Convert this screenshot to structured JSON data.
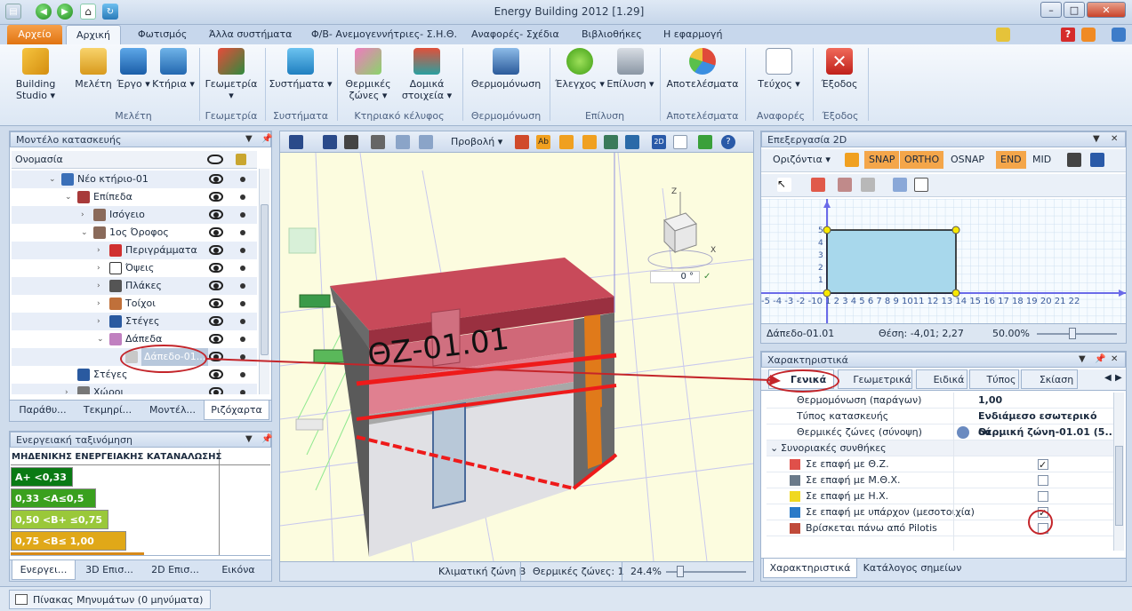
{
  "app": {
    "title": "Energy Building 2012 [1.29]"
  },
  "ribbon_tabs": [
    "Αρχείο",
    "Αρχική",
    "Φωτισμός",
    "Άλλα συστήματα",
    "Φ/Β- Ανεμογεννήτριες- Σ.Η.Θ.",
    "Αναφορές- Σχέδια",
    "Βιβλιοθήκες",
    "Η εφαρμογή"
  ],
  "ribbon": {
    "building_studio": [
      "Building",
      "Studio ▾"
    ],
    "meleti": "Μελέτη",
    "ergo": "Έργο ▾",
    "ktiria": "Κτήρια ▾",
    "geometria": "Γεωμετρία ▾",
    "systimata": "Συστήματα ▾",
    "thermikes_zones": [
      "Θερμικές",
      "ζώνες ▾"
    ],
    "domika": [
      "Δομικά",
      "στοιχεία ▾"
    ],
    "thermomonosi": "Θερμομόνωση",
    "elegxos": "Έλεγχος ▾",
    "epilysi": "Επίλυση ▾",
    "apotelesmata": "Αποτελέσματα",
    "teuxos": "Τεύχος ▾",
    "exodos": "Έξοδος",
    "groups": [
      "Μελέτη",
      "Γεωμετρία",
      "Συστήματα",
      "Κτηριακό κέλυφος",
      "Θερμομόνωση",
      "Επίλυση",
      "Αποτελέσματα",
      "Αναφορές",
      "Έξοδος"
    ]
  },
  "model_panel": {
    "title": "Μοντέλο κατασκευής",
    "column": "Ονομασία",
    "rows": [
      "Νέο κτήριο-01",
      "Επίπεδα",
      "Ισόγειο",
      "1ος Όροφος",
      "Περιγράμματα",
      "Όψεις",
      "Πλάκες",
      "Τοίχοι",
      "Στέγες",
      "Δάπεδα",
      "Δάπεδο-01...",
      "Στέγες",
      "Χώροι"
    ],
    "tabs": [
      "Παράθυ...",
      "Τεκμηρί...",
      "Μοντέλ...",
      "Ριζόχαρτα"
    ]
  },
  "energy_panel": {
    "title": "Ενεργειακή ταξινόμηση",
    "header": "ΜΗΔΕΝΙΚΗΣ ΕΝΕΡΓΕΙΑΚΗΣ ΚΑΤΑΝΑΛΩΣΗΣ",
    "classes": [
      "A+ <0,33",
      "0,33 <A≤0,5",
      "0,50 <B+ ≤0,75",
      "0,75 <B≤ 1,00"
    ],
    "tabs": [
      "Ενεργει...",
      "3D Επισ...",
      "2D Επισ...",
      "Εικόνα"
    ]
  },
  "viewport": {
    "view_label": "Προβολή",
    "zone_label": "ΘΖ-01.01",
    "angle": "0 °",
    "axis_z": "Z",
    "axis_x": "X",
    "status": {
      "climate": "Κλιματική ζώνη Β",
      "zones": "Θερμικές ζώνες: 1",
      "zoom": "24.4%"
    }
  },
  "edit2d": {
    "title": "Επεξεργασία 2D",
    "mode": "Οριζόντια",
    "snap": "SNAP",
    "ortho": "ORTHO",
    "osnap": "OSNAP",
    "end": "END",
    "mid": "MID",
    "ruler": "-5 -4 -3 -2 -10   1  2  3  4  5  6  7  8  9 1011 12 13 14 15 16 17 18 19 20 21 22",
    "y_ticks": [
      "5",
      "4",
      "3",
      "2",
      "1"
    ],
    "status": {
      "name": "Δάπεδο-01.01",
      "pos": "Θέση: -4,01; 2,27",
      "zoom": "50.00%"
    }
  },
  "props": {
    "title": "Χαρακτηριστικά",
    "tabs": [
      "Γενικά",
      "Γεωμετρικά",
      "Ειδικά",
      "Τύπος",
      "Σκίαση"
    ],
    "rows": [
      {
        "l": "Θερμομόνωση (παράγων)",
        "v": "1,00"
      },
      {
        "l": "Τύπος κατασκευής",
        "v": "Ενδιάμεσο εσωτερικό δά..."
      },
      {
        "l": "Θερμικές ζώνες (σύνοψη)",
        "v": "Θερμική ζώνη-01.01 (5..."
      }
    ],
    "section": "Συνοριακές συνθήκες",
    "checks": [
      {
        "l": "Σε επαφή με Θ.Ζ.",
        "on": true
      },
      {
        "l": "Σε επαφή με Μ.Θ.Χ.",
        "on": false
      },
      {
        "l": "Σε επαφή με Η.Χ.",
        "on": false
      },
      {
        "l": "Σε επαφή με υπάρχον (μεσοτοιχία)",
        "on": true
      },
      {
        "l": "Βρίσκεται πάνω από Pilotis",
        "on": false
      }
    ],
    "bottom_tabs": [
      "Χαρακτηριστικά",
      "Κατάλογος σημείων"
    ]
  },
  "messages": "Πίνακας Μηνυμάτων (0 μηνύματα)"
}
